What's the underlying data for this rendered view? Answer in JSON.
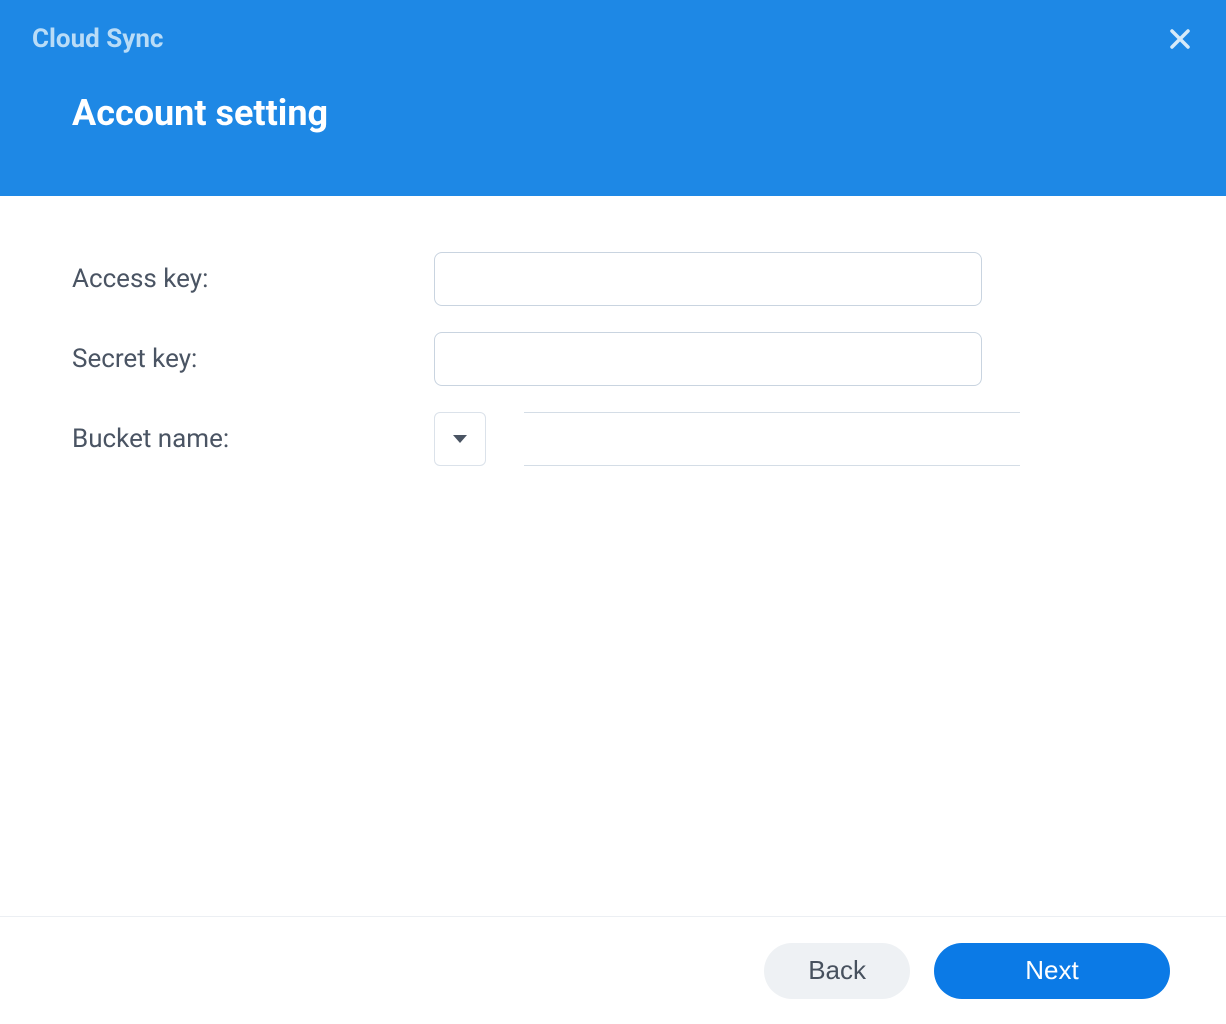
{
  "header": {
    "app_title": "Cloud Sync",
    "page_title": "Account setting"
  },
  "form": {
    "access_key": {
      "label": "Access key:",
      "value": ""
    },
    "secret_key": {
      "label": "Secret key:",
      "value": ""
    },
    "bucket_name": {
      "label": "Bucket name:",
      "value": ""
    }
  },
  "footer": {
    "back_label": "Back",
    "next_label": "Next"
  }
}
